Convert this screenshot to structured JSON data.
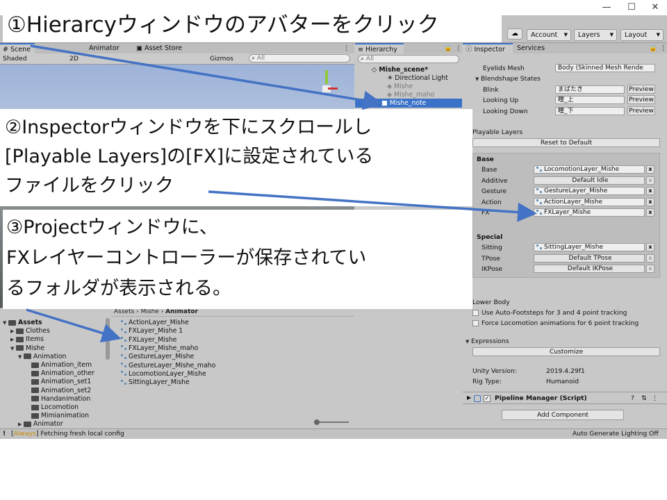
{
  "toolbar": {
    "account": "Account",
    "layers": "Layers",
    "layout": "Layout"
  },
  "scene": {
    "tab_scene": "Scene",
    "tab_animator": "Animator",
    "tab_asset_store": "Asset Store",
    "shading": "Shaded",
    "mode_2d": "2D",
    "gizmos": "Gizmos",
    "search_placeholder": "All"
  },
  "hierarchy": {
    "tab": "Hierarchy",
    "search_placeholder": "All",
    "items": [
      {
        "label": "Mishe_scene*"
      },
      {
        "label": "Directional Light"
      },
      {
        "label": "Mishe"
      },
      {
        "label": "Mishe_maho"
      },
      {
        "label": "Mishe_note"
      }
    ]
  },
  "inspector": {
    "tab_inspector": "Inspector",
    "tab_services": "Services",
    "eyelids_label": "Eyelids Mesh",
    "eyelids_value": "Body (Skinned Mesh Rende",
    "blendshape_header": "Blendshape States",
    "blendshapes": [
      {
        "label": "Blink",
        "value": "まばたき",
        "btn": "Preview"
      },
      {
        "label": "Looking Up",
        "value": "瞳_上",
        "btn": "Preview"
      },
      {
        "label": "Looking Down",
        "value": "瞳_下",
        "btn": "Preview"
      }
    ],
    "playable_layers": "Playable Layers",
    "reset_default": "Reset to Default",
    "base_header": "Base",
    "base": [
      {
        "label": "Base",
        "value": "LocomotionLayer_Mishe"
      },
      {
        "label": "Additive",
        "value": "Default Idle"
      },
      {
        "label": "Gesture",
        "value": "GestureLayer_Mishe"
      },
      {
        "label": "Action",
        "value": "ActionLayer_Mishe"
      },
      {
        "label": "FX",
        "value": "FXLayer_Mishe"
      }
    ],
    "special_header": "Special",
    "special": [
      {
        "label": "Sitting",
        "value": "SittingLayer_Mishe"
      },
      {
        "label": "TPose",
        "value": "Default TPose"
      },
      {
        "label": "IKPose",
        "value": "Default IKPose"
      }
    ],
    "lower_body": "Lower Body",
    "auto_footsteps": "Use Auto-Footsteps for 3 and 4 point tracking",
    "force_locomotion": "Force Locomotion animations for 6 point tracking",
    "expressions": "Expressions",
    "customize": "Customize",
    "unity_version_label": "Unity Version:",
    "unity_version": "2019.4.29f1",
    "rig_type_label": "Rig Type:",
    "rig_type": "Humanoid",
    "pipeline_manager": "Pipeline Manager (Script)",
    "add_component": "Add Component"
  },
  "project": {
    "breadcrumb": [
      "Assets",
      "Mishe",
      "Animator"
    ],
    "tree": [
      {
        "label": "Assets",
        "level": 0
      },
      {
        "label": "Clothes",
        "level": 1
      },
      {
        "label": "Items",
        "level": 1
      },
      {
        "label": "Mishe",
        "level": 1
      },
      {
        "label": "Animation",
        "level": 2
      },
      {
        "label": "Animation_item",
        "level": 3
      },
      {
        "label": "Animation_other",
        "level": 3
      },
      {
        "label": "Animation_set1",
        "level": 3
      },
      {
        "label": "Animation_set2",
        "level": 3
      },
      {
        "label": "Handanimation",
        "level": 3
      },
      {
        "label": "Locomotion",
        "level": 3
      },
      {
        "label": "Mimianimation",
        "level": 3
      },
      {
        "label": "Animator",
        "level": 2
      }
    ],
    "files": [
      "ActionLayer_Mishe",
      "FXLayer_Mishe 1",
      "FXLayer_Mishe",
      "FXLayer_Mishe_maho",
      "GestureLayer_Mishe",
      "GestureLayer_Mishe_maho",
      "LocomotionLayer_Mishe",
      "SittingLayer_Mishe"
    ]
  },
  "status": {
    "tag": "Always",
    "message": "Fetching fresh local config",
    "right": "Auto Generate Lighting Off"
  },
  "callouts": {
    "c1": "①Hierarcyウィンドウのアバターをクリック",
    "c2": [
      "②Inspectorウィンドウを下にスクロールし",
      "[Playable Layers]の[FX]に設定されている",
      "ファイルをクリック"
    ],
    "c3": [
      "③Projectウィンドウに、",
      "FXレイヤーコントローラーが保存されてい",
      "るフォルダが表示される。"
    ]
  },
  "colors": {
    "arrow": "#4472c4",
    "selection": "#3a72c8",
    "editor_bg": "#c8c8c8"
  }
}
